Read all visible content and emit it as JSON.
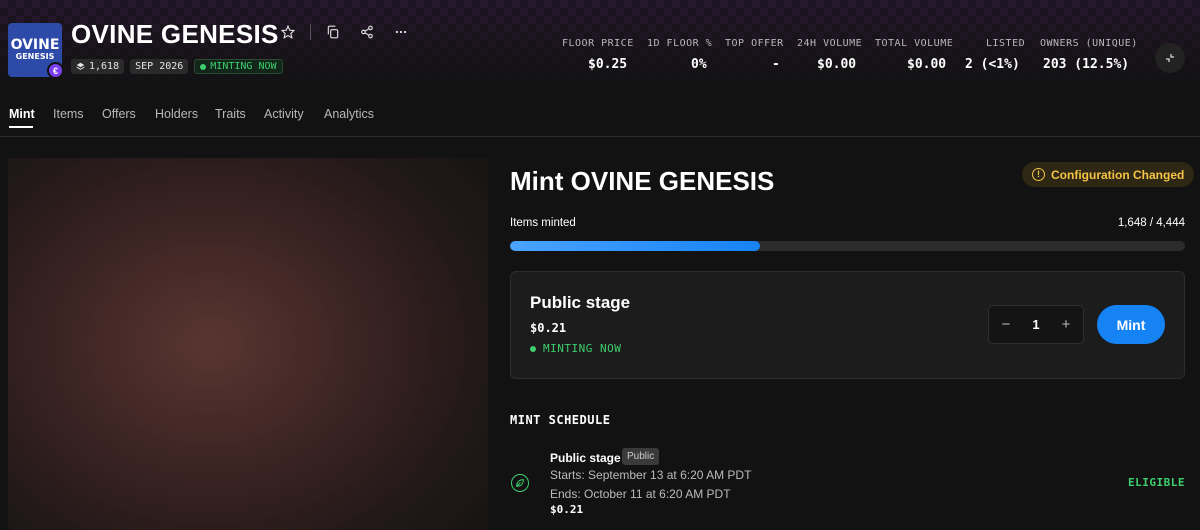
{
  "collection": {
    "logo_line1": "OVINE",
    "logo_line2": "GENESIS",
    "logo_badge": "€",
    "title": "OVINE GENESIS",
    "chips": {
      "supply": "1,618",
      "date": "SEP 2026",
      "status": "MINTING NOW"
    }
  },
  "stats": [
    {
      "label": "FLOOR PRICE",
      "value": "$0.25"
    },
    {
      "label": "1D FLOOR %",
      "value": "0%"
    },
    {
      "label": "TOP OFFER",
      "value": "-"
    },
    {
      "label": "24H VOLUME",
      "value": "$0.00"
    },
    {
      "label": "TOTAL VOLUME",
      "value": "$0.00"
    },
    {
      "label": "LISTED",
      "value": "2 (<1%)"
    },
    {
      "label": "OWNERS (UNIQUE)",
      "value": "203 (12.5%)"
    }
  ],
  "tabs": [
    "Mint",
    "Items",
    "Offers",
    "Holders",
    "Traits",
    "Activity",
    "Analytics"
  ],
  "mint": {
    "title": "Mint OVINE GENESIS",
    "config_badge": "Configuration Changed",
    "items_label": "Items minted",
    "items_count": "1,648 / 4,444",
    "progress": 0.371,
    "stage": {
      "name": "Public stage",
      "price": "$0.21",
      "status": "MINTING NOW",
      "quantity": "1",
      "decrement": "−",
      "increment": "+",
      "button": "Mint"
    }
  },
  "schedule": {
    "title": "MINT SCHEDULE",
    "items": [
      {
        "name": "Public stage",
        "badge": "Public",
        "starts": "Starts: September 13 at 6:20 AM PDT",
        "ends": "Ends: October 11 at 6:20 AM PDT",
        "price": "$0.21",
        "eligibility": "ELIGIBLE"
      }
    ]
  },
  "colors": {
    "accent": "#1683f5",
    "success": "#3ecf6e",
    "warning": "#f6c445",
    "background": "#121212"
  }
}
